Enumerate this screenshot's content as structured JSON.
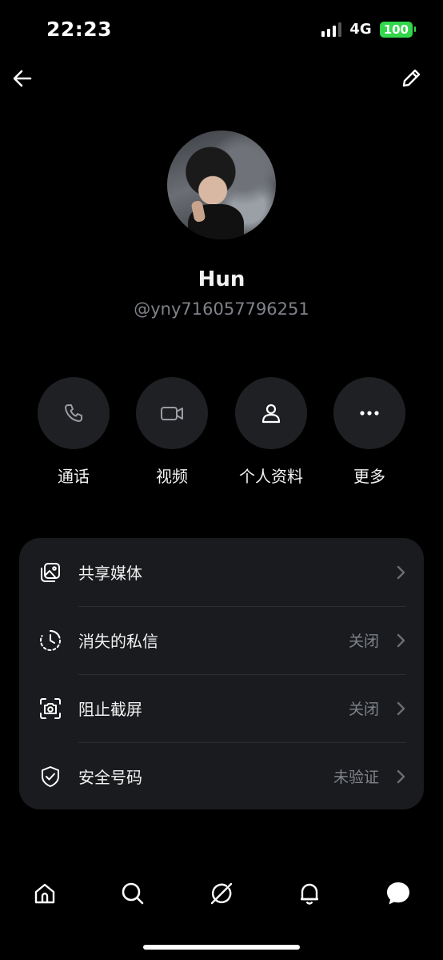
{
  "status_bar": {
    "time": "22:23",
    "network": "4G",
    "battery": "100",
    "battery_color": "#32d74b"
  },
  "nav": {
    "back_icon": "arrow-left-icon",
    "edit_icon": "pencil-icon"
  },
  "profile": {
    "name": "Hun",
    "handle": "@yny716057796251"
  },
  "actions": [
    {
      "label": "通话",
      "icon": "phone-icon"
    },
    {
      "label": "视频",
      "icon": "video-icon"
    },
    {
      "label": "个人资料",
      "icon": "person-icon"
    },
    {
      "label": "更多",
      "icon": "more-icon"
    }
  ],
  "settings": [
    {
      "title": "共享媒体",
      "value": "",
      "icon": "media-icon"
    },
    {
      "title": "消失的私信",
      "value": "关闭",
      "icon": "timer-icon"
    },
    {
      "title": "阻止截屏",
      "value": "关闭",
      "icon": "screenshot-icon"
    },
    {
      "title": "安全号码",
      "value": "未验证",
      "icon": "shield-icon"
    }
  ],
  "tabbar": [
    "home-icon",
    "search-icon",
    "grok-icon",
    "notifications-icon",
    "messages-icon"
  ],
  "colors": {
    "background": "#000000",
    "card": "#1a1b1e",
    "button": "#1f2023",
    "secondary_text": "#7f8389"
  }
}
